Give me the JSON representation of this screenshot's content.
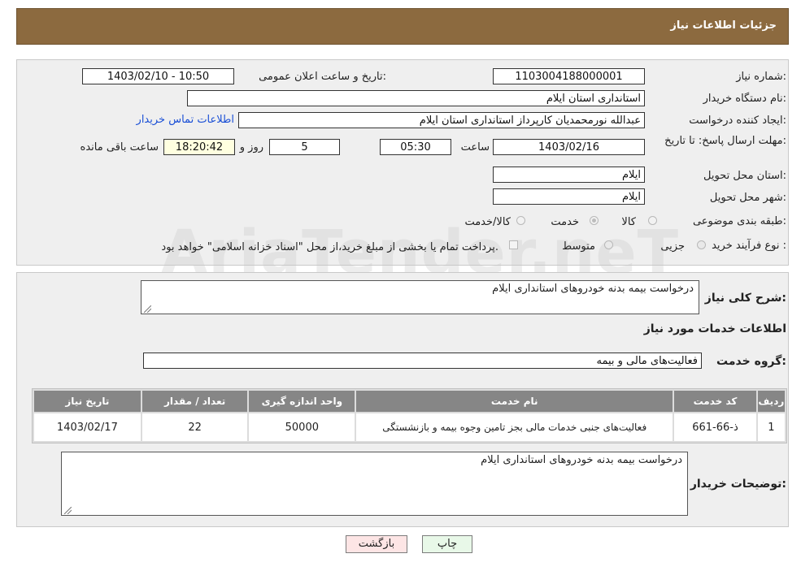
{
  "header": {
    "title": "جزئیات اطلاعات نیاز"
  },
  "watermark": "AriaTender.neT",
  "details": {
    "need_number_label": "شماره نیاز:",
    "need_number": "1103004188000001",
    "announce_label": "تاریخ و ساعت اعلان عمومی:",
    "announce_value": "1403/02/10 - 10:50",
    "buyer_org_label": "نام دستگاه خریدار:",
    "buyer_org": "استانداری استان ایلام",
    "creator_label": "ایجاد کننده درخواست:",
    "creator": "عبدالله نورمحمدیان کارپرداز استانداری استان ایلام",
    "contact_link": "اطلاعات تماس خریدار",
    "deadline_label": "مهلت ارسال پاسخ: تا تاریخ:",
    "deadline_date": "1403/02/16",
    "time_label": "ساعت",
    "deadline_time": "05:30",
    "days_value": "5",
    "days_label": "روز و",
    "remaining_time": "18:20:42",
    "remaining_label": "ساعت باقی مانده",
    "province_label": "استان محل تحویل:",
    "province": "ایلام",
    "city_label": "شهر محل تحویل:",
    "city": "ایلام",
    "category_label": "طبقه بندی موضوعی:",
    "category_options": [
      "کالا",
      "خدمت",
      "کالا/خدمت"
    ],
    "category_selected": "خدمت",
    "process_label": "نوع فرآیند خرید :",
    "process_options": [
      "جزیی",
      "متوسط"
    ],
    "payment_note": "پرداخت تمام یا بخشی از مبلغ خرید،از محل \"اسناد خزانه اسلامی\" خواهد بود."
  },
  "summary": {
    "general_desc_label": "شرح کلی نیاز:",
    "general_desc": "درخواست بیمه بدنه خودروهای استانداری ایلام",
    "services_title": "اطلاعات خدمات مورد نیاز",
    "service_group_label": "گروه خدمت:",
    "service_group": "فعالیت‌های مالی و بیمه",
    "table": {
      "headers": [
        "ردیف",
        "کد خدمت",
        "نام خدمت",
        "واحد اندازه گیری",
        "تعداد / مقدار",
        "تاریخ نیاز"
      ],
      "rows": [
        [
          "1",
          "ذ-66-661",
          "فعالیت‌های جنبی خدمات مالی بجز تامین وجوه بیمه و بازنشستگی",
          "50000",
          "22",
          "1403/02/17"
        ]
      ]
    },
    "buyer_notes_label": "توضیحات خریدار:",
    "buyer_notes": "درخواست بیمه بدنه خودروهای استانداری ایلام"
  },
  "buttons": {
    "print": "چاپ",
    "back": "بازگشت"
  },
  "colors": {
    "header_bg": "#8c6a3f",
    "table_header_bg": "#868686",
    "link": "#1a4fd6",
    "back_button_bg": "#fde5e5",
    "print_button_bg": "#e8f8e8"
  }
}
